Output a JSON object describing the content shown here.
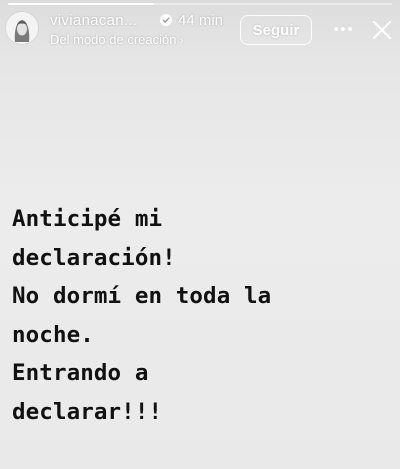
{
  "progress": {
    "fraction": 0.38
  },
  "header": {
    "username": "vivianacan...",
    "time": "44 min",
    "subtitle": "Del modo de creación",
    "subtitle_chevron": "›",
    "follow_label": "Seguir",
    "more_icon": "more-horizontal-icon",
    "close_icon": "close-icon",
    "verified_icon": "verified-badge-icon"
  },
  "story": {
    "lines": [
      "Anticipé mi",
      "declaración!",
      "No dormí en toda la",
      "noche.",
      "Entrando a",
      "declarar!!!"
    ]
  },
  "colors": {
    "background": "#e9e9e9",
    "text": "#111111",
    "header_text": "#ffffff"
  }
}
